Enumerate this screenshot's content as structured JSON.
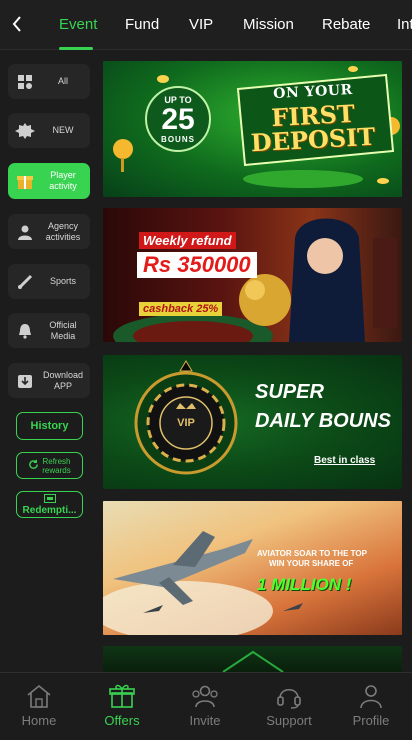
{
  "tabs": [
    {
      "label": "Event",
      "active": true
    },
    {
      "label": "Fund"
    },
    {
      "label": "VIP"
    },
    {
      "label": "Mission"
    },
    {
      "label": "Rebate"
    },
    {
      "label": "Int"
    }
  ],
  "sidebar": {
    "items": [
      {
        "label": "All",
        "icon": "grid-icon"
      },
      {
        "label": "NEW",
        "icon": "new-badge-icon",
        "icon_text": "NEW"
      },
      {
        "label": "Player activity",
        "icon": "gift-icon",
        "active": true
      },
      {
        "label": "Agency activities",
        "icon": "agent-icon"
      },
      {
        "label": "Sports",
        "icon": "sports-icon"
      },
      {
        "label": "Official Media",
        "icon": "bell-icon"
      },
      {
        "label": "Download APP",
        "icon": "download-icon"
      }
    ],
    "history_label": "History",
    "refresh_label_1": "Refresh",
    "refresh_label_2": "rewards",
    "redemption_label": "Redempti..."
  },
  "banners": [
    {
      "up_to": "UP TO",
      "amount": "25",
      "bonus_word": "BOUNS",
      "line1": "ON YOUR",
      "line2": "FIRST",
      "line3": "DEPOSIT"
    },
    {
      "line1": "Weekly refund",
      "line2": "Rs 350000",
      "line3": "cashback 25%"
    },
    {
      "chip": "VIP",
      "line1": "SUPER",
      "line2": "DAILY BOUNS",
      "line3": "Best in class"
    },
    {
      "line1": "AVIATOR SOAR TO THE TOP",
      "line2": "WIN YOUR SHARE OF",
      "line3": "1 MILLION !"
    }
  ],
  "bottom_nav": [
    {
      "label": "Home",
      "icon": "home-icon"
    },
    {
      "label": "Offers",
      "icon": "gift-icon",
      "active": true
    },
    {
      "label": "Invite",
      "icon": "invite-icon"
    },
    {
      "label": "Support",
      "icon": "headset-icon"
    },
    {
      "label": "Profile",
      "icon": "profile-icon"
    }
  ],
  "colors": {
    "accent": "#39d352",
    "background": "#1c1c1c",
    "panel": "#262626"
  }
}
